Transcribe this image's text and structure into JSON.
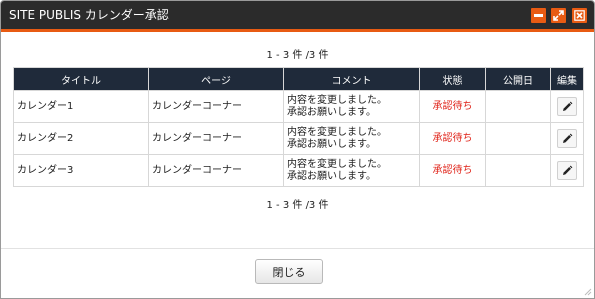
{
  "dialog": {
    "title": "SITE PUBLIS カレンダー承認",
    "window_buttons": [
      {
        "name": "minimize-icon"
      },
      {
        "name": "maximize-icon"
      },
      {
        "name": "close-icon"
      }
    ],
    "accent_color": "#e85b13",
    "titlebar_color": "#2b2b2b"
  },
  "pager": {
    "top": "1 - 3 件 /3 件",
    "bottom": "1 - 3 件 /3 件"
  },
  "table": {
    "columns": [
      "タイトル",
      "ページ",
      "コメント",
      "状態",
      "公開日",
      "編集"
    ],
    "rows": [
      {
        "title": "カレンダー1",
        "page": "カレンダーコーナー",
        "comment_line1": "内容を変更しました。",
        "comment_line2": "承認お願いします。",
        "status": "承認待ち",
        "published": ""
      },
      {
        "title": "カレンダー2",
        "page": "カレンダーコーナー",
        "comment_line1": "内容を変更しました。",
        "comment_line2": "承認お願いします。",
        "status": "承認待ち",
        "published": ""
      },
      {
        "title": "カレンダー3",
        "page": "カレンダーコーナー",
        "comment_line1": "内容を変更しました。",
        "comment_line2": "承認お願いします。",
        "status": "承認待ち",
        "published": ""
      }
    ],
    "header_color": "#1f2a3a",
    "status_color": "#e0251b",
    "edit_icon": "pencil-icon"
  },
  "footer": {
    "close_label": "閉じる"
  }
}
